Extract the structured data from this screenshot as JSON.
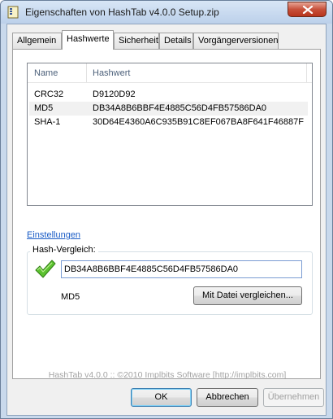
{
  "window": {
    "title": "Eigenschaften von HashTab v4.0.0 Setup.zip",
    "close_icon": "close-icon",
    "app_icon": "zip-file-icon"
  },
  "tabs": [
    {
      "label": "Allgemein",
      "active": false
    },
    {
      "label": "Hashwerte",
      "active": true
    },
    {
      "label": "Sicherheit",
      "active": false
    },
    {
      "label": "Details",
      "active": false
    },
    {
      "label": "Vorgängerversionen",
      "active": false
    }
  ],
  "hash_list": {
    "columns": [
      "Name",
      "Hashwert"
    ],
    "rows": [
      {
        "name": "CRC32",
        "value": "D9120D92"
      },
      {
        "name": "MD5",
        "value": "DB34A8B6BBF4E4885C56D4FB57586DA0"
      },
      {
        "name": "SHA-1",
        "value": "30D64E4360A6C935B91C8EF067BA8F641F46887F"
      }
    ]
  },
  "settings_link": "Einstellungen",
  "hash_compare": {
    "legend": "Hash-Vergleich:",
    "input_value": "DB34A8B6BBF4E4885C56D4FB57586DA0",
    "match_icon": "green-checkmark-icon",
    "algorithm": "MD5",
    "compare_button": "Mit Datei vergleichen..."
  },
  "footer": "HashTab v4.0.0 :: ©2010 Implbits Software [http://implbits.com]",
  "buttons": {
    "ok": "OK",
    "cancel": "Abbrechen",
    "apply": "Übernehmen"
  },
  "colors": {
    "link": "#1a5cc6",
    "check": "#4caf2a",
    "close": "#c7503a"
  }
}
